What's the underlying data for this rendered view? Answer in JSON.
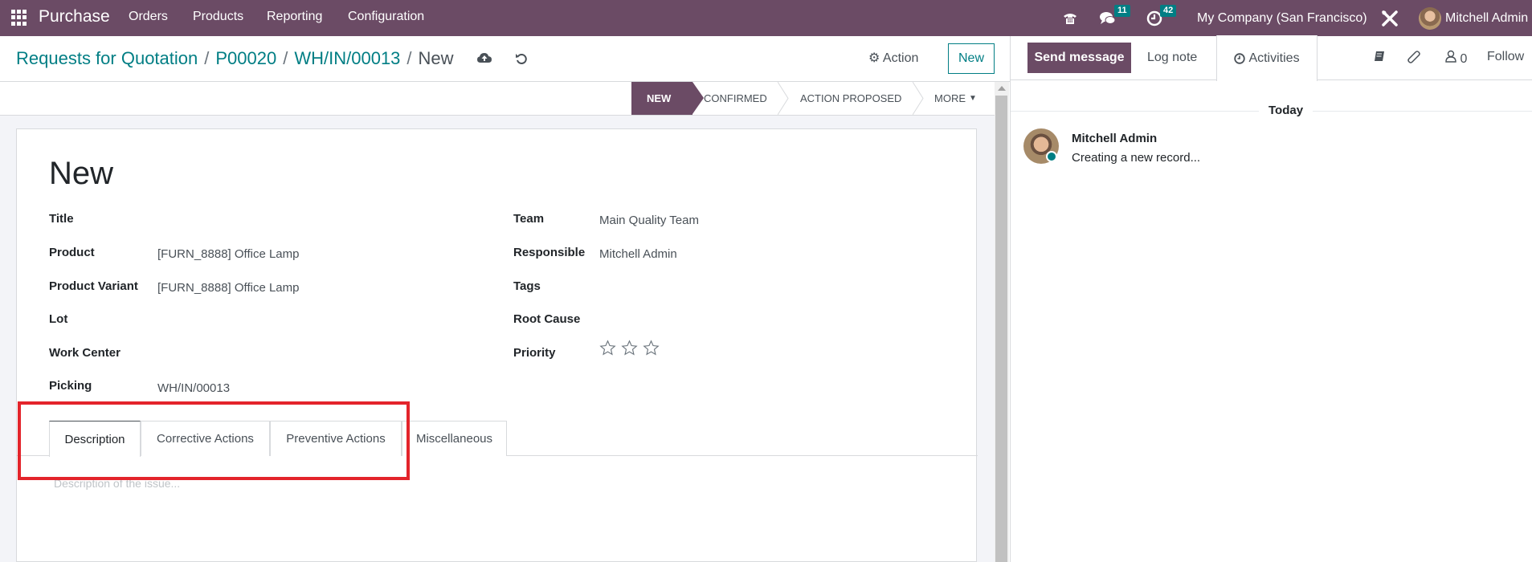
{
  "navbar": {
    "app_name": "Purchase",
    "menu": [
      "Orders",
      "Products",
      "Reporting",
      "Configuration"
    ],
    "messages_count": "11",
    "activities_count": "42",
    "company": "My Company (San Francisco)",
    "user": "Mitchell Admin",
    "colors": {
      "brand": "#6b4b65",
      "badge": "#017e84"
    }
  },
  "breadcrumb": {
    "items": [
      "Requests for Quotation",
      "P00020",
      "WH/IN/00013"
    ],
    "current": "New"
  },
  "control": {
    "action_label": "Action",
    "new_label": "New"
  },
  "statusbar": {
    "stages": [
      "NEW",
      "CONFIRMED",
      "ACTION PROPOSED"
    ],
    "active_stage": "NEW",
    "more_label": "MORE"
  },
  "form": {
    "title": "New",
    "left_fields": [
      {
        "label": "Title",
        "value": ""
      },
      {
        "label": "Product",
        "value": "[FURN_8888] Office Lamp"
      },
      {
        "label": "Product Variant",
        "value": "[FURN_8888] Office Lamp"
      },
      {
        "label": "Lot",
        "value": ""
      },
      {
        "label": "Work Center",
        "value": ""
      },
      {
        "label": "Picking",
        "value": "WH/IN/00013"
      }
    ],
    "right_fields": [
      {
        "label": "Team",
        "value": "Main Quality Team"
      },
      {
        "label": "Responsible",
        "value": "Mitchell Admin"
      },
      {
        "label": "Tags",
        "value": ""
      },
      {
        "label": "Root Cause",
        "value": ""
      },
      {
        "label": "Priority",
        "value": ""
      }
    ],
    "priority": {
      "value": 0,
      "max": 3
    },
    "tabs": [
      "Description",
      "Corrective Actions",
      "Preventive Actions",
      "Miscellaneous"
    ],
    "active_tab": "Description",
    "description_placeholder": "Description of the issue..."
  },
  "chatter": {
    "send_message": "Send message",
    "log_note": "Log note",
    "activities": "Activities",
    "followers_count": "0",
    "follow": "Follow",
    "date_separator": "Today",
    "messages": [
      {
        "author": "Mitchell Admin",
        "body": "Creating a new record..."
      }
    ]
  }
}
